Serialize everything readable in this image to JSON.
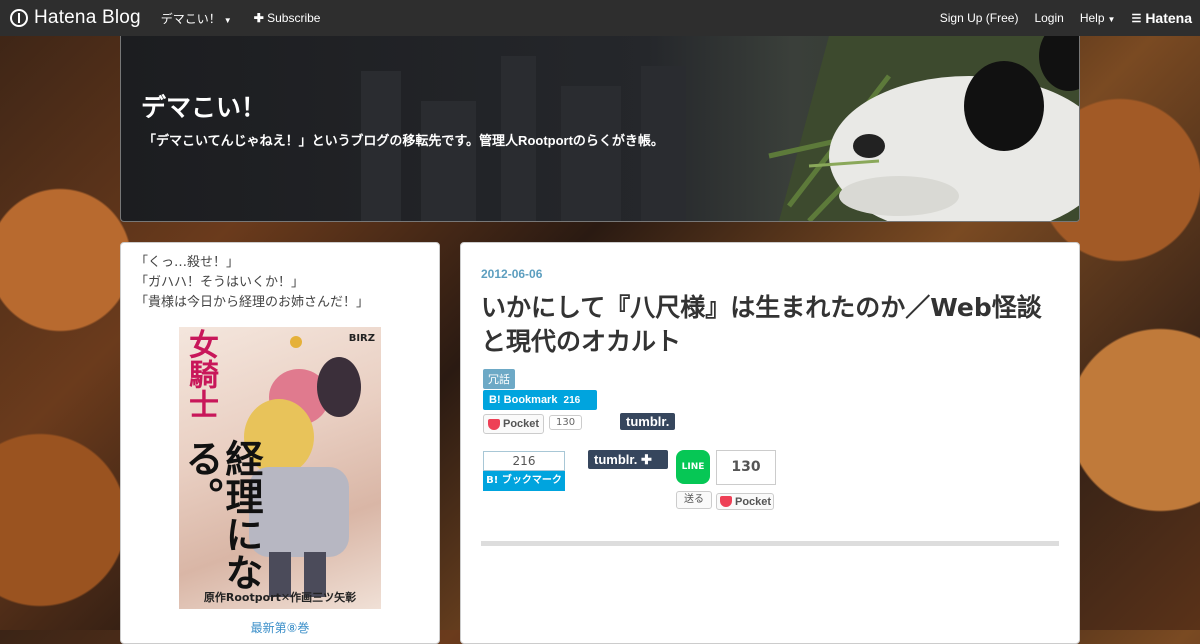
{
  "topbar": {
    "logo_text": "Hatena Blog",
    "blog_menu_label": "デマこい！",
    "subscribe_label": "Subscribe",
    "signup_label": "Sign Up (Free)",
    "login_label": "Login",
    "help_label": "Help",
    "hatena_label": "Hatena"
  },
  "header": {
    "title": "デマこい！",
    "description": "「デマこいてんじゃねえ！」というブログの移転先です。管理人Rootportのらくがき帳。"
  },
  "sidebar": {
    "quotes": [
      "「くっ…殺せ！」",
      "「ガハハ！そうはいくか！」",
      "「貴様は今日から経理のお姉さんだ！」"
    ],
    "cover": {
      "title_top": "女騎士",
      "title_big": "経理になる。",
      "label": "BIRZ",
      "volume": "8",
      "credit": "原作Rootport✕作画三ツ矢彰"
    },
    "latest_link": "最新第⑧巻"
  },
  "article": {
    "date": "2012-06-06",
    "title": "いかにして『八尺様』は生まれたのか／Web怪談と現代のオカルト",
    "category": "冗話",
    "share": {
      "hatena_bookmark_label": "B! Bookmark",
      "hatena_bookmark_count": "216",
      "pocket_label": "Pocket",
      "pocket_count": "130",
      "tumblr_label": "tumblr.",
      "hatena_box_count": "216",
      "hatena_box_label": "B! ブックマーク",
      "tumblr_big_label": "tumblr. ✚",
      "line_label": "LINE",
      "line_send_label": "送る",
      "pocket_big_count": "130",
      "pocket_big_label": "Pocket"
    }
  }
}
